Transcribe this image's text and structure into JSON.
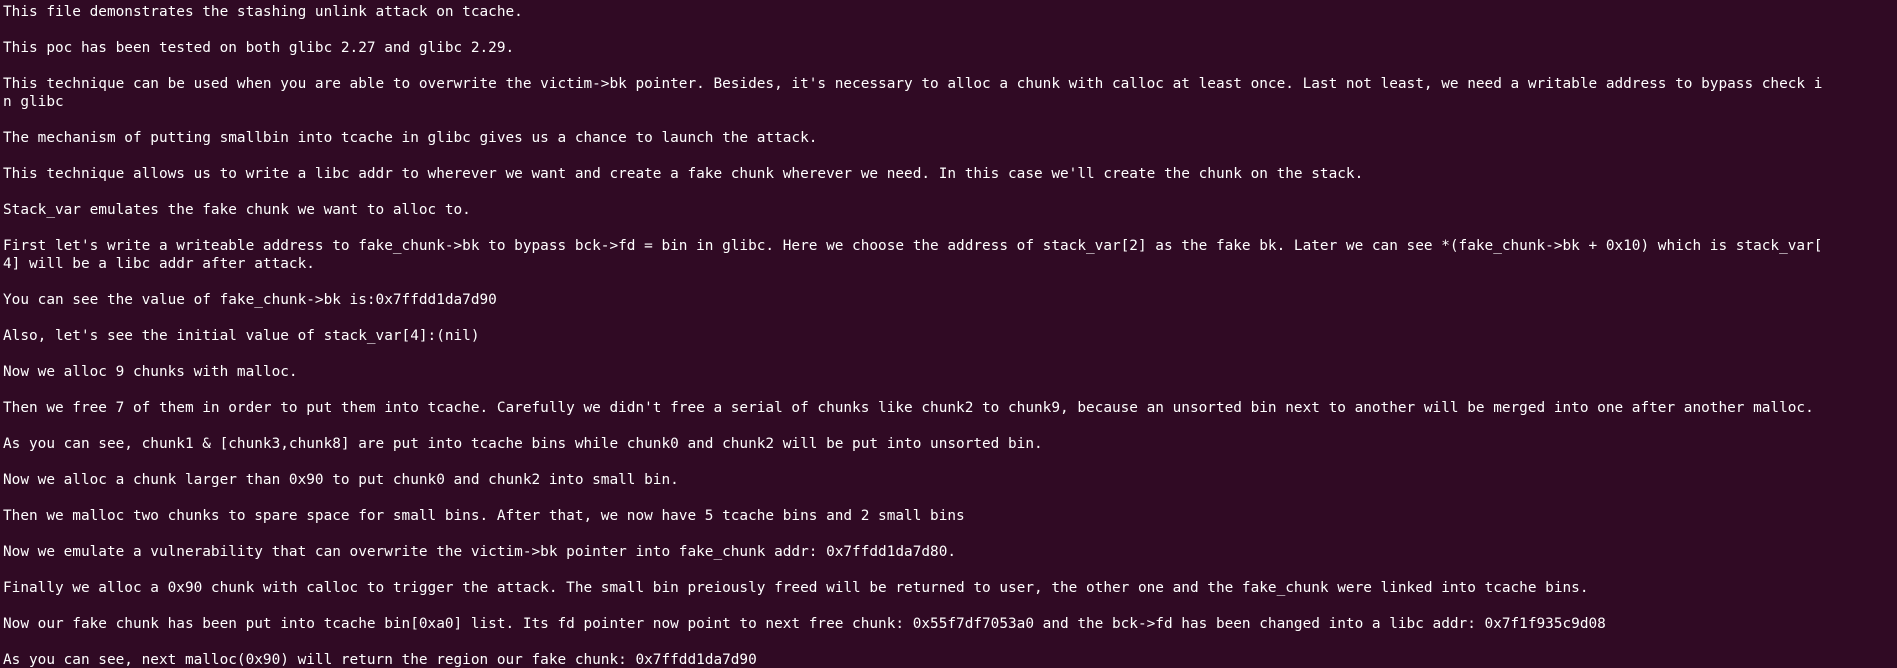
{
  "terminal": {
    "lines": [
      "This file demonstrates the stashing unlink attack on tcache.",
      "",
      "This poc has been tested on both glibc 2.27 and glibc 2.29.",
      "",
      "This technique can be used when you are able to overwrite the victim->bk pointer. Besides, it's necessary to alloc a chunk with calloc at least once. Last not least, we need a writable address to bypass check i",
      "n glibc",
      "",
      "The mechanism of putting smallbin into tcache in glibc gives us a chance to launch the attack.",
      "",
      "This technique allows us to write a libc addr to wherever we want and create a fake chunk wherever we need. In this case we'll create the chunk on the stack.",
      "",
      "Stack_var emulates the fake chunk we want to alloc to.",
      "",
      "First let's write a writeable address to fake_chunk->bk to bypass bck->fd = bin in glibc. Here we choose the address of stack_var[2] as the fake bk. Later we can see *(fake_chunk->bk + 0x10) which is stack_var[",
      "4] will be a libc addr after attack.",
      "",
      "You can see the value of fake_chunk->bk is:0x7ffdd1da7d90",
      "",
      "Also, let's see the initial value of stack_var[4]:(nil)",
      "",
      "Now we alloc 9 chunks with malloc.",
      "",
      "Then we free 7 of them in order to put them into tcache. Carefully we didn't free a serial of chunks like chunk2 to chunk9, because an unsorted bin next to another will be merged into one after another malloc.",
      "",
      "As you can see, chunk1 & [chunk3,chunk8] are put into tcache bins while chunk0 and chunk2 will be put into unsorted bin.",
      "",
      "Now we alloc a chunk larger than 0x90 to put chunk0 and chunk2 into small bin.",
      "",
      "Then we malloc two chunks to spare space for small bins. After that, we now have 5 tcache bins and 2 small bins",
      "",
      "Now we emulate a vulnerability that can overwrite the victim->bk pointer into fake_chunk addr: 0x7ffdd1da7d80.",
      "",
      "Finally we alloc a 0x90 chunk with calloc to trigger the attack. The small bin preiously freed will be returned to user, the other one and the fake_chunk were linked into tcache bins.",
      "",
      "Now our fake chunk has been put into tcache bin[0xa0] list. Its fd pointer now point to next free chunk: 0x55f7df7053a0 and the bck->fd has been changed into a libc addr: 0x7f1f935c9d08",
      "",
      "As you can see, next malloc(0x90) will return the region our fake chunk: 0x7ffdd1da7d90"
    ],
    "colors": {
      "background": "#300a24",
      "foreground": "#ffffff"
    }
  }
}
